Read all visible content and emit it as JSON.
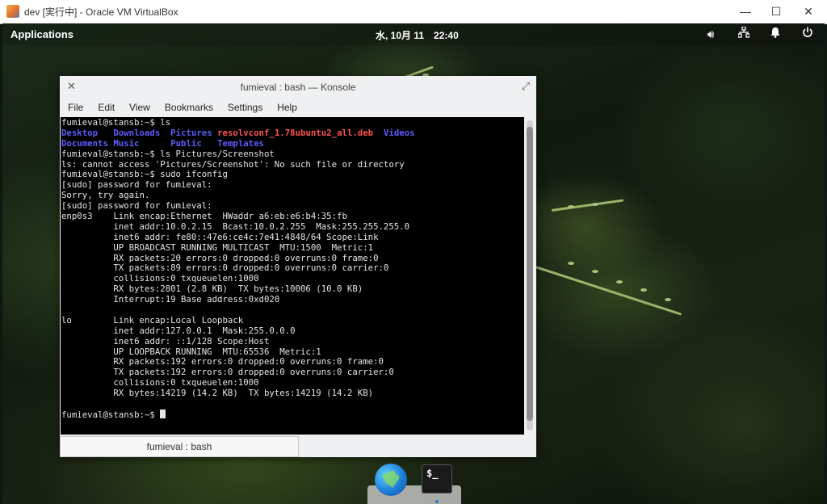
{
  "host_window": {
    "title": "dev [実行中] - Oracle VM VirtualBox",
    "controls": {
      "minimize": "—",
      "maximize": "☐",
      "close": "✕"
    }
  },
  "top_panel": {
    "applications_label": "Applications",
    "date": "水, 10月 11",
    "time": "22:40",
    "tray_icons": [
      "volume-icon",
      "network-icon",
      "notifications-icon",
      "power-icon"
    ]
  },
  "konsole": {
    "title": "fumieval : bash — Konsole",
    "menu": [
      "File",
      "Edit",
      "View",
      "Bookmarks",
      "Settings",
      "Help"
    ],
    "tab_label": "fumieval : bash",
    "lines": [
      "fumieval@stansb:~$ ls",
      "",
      "",
      "fumieval@stansb:~$ ls Pictures/Screenshot",
      "ls: cannot access 'Pictures/Screenshot': No such file or directory",
      "fumieval@stansb:~$ sudo ifconfig",
      "[sudo] password for fumieval:",
      "Sorry, try again.",
      "[sudo] password for fumieval:",
      "enp0s3    Link encap:Ethernet  HWaddr a6:eb:e6:b4:35:fb",
      "          inet addr:10.0.2.15  Bcast:10.0.2.255  Mask:255.255.255.0",
      "          inet6 addr: fe80::47e6:ce4c:7e41:4848/64 Scope:Link",
      "          UP BROADCAST RUNNING MULTICAST  MTU:1500  Metric:1",
      "          RX packets:20 errors:0 dropped:0 overruns:0 frame:0",
      "          TX packets:89 errors:0 dropped:0 overruns:0 carrier:0",
      "          collisions:0 txqueuelen:1000",
      "          RX bytes:2801 (2.8 KB)  TX bytes:10006 (10.0 KB)",
      "          Interrupt:19 Base address:0xd020",
      "",
      "lo        Link encap:Local Loopback",
      "          inet addr:127.0.0.1  Mask:255.0.0.0",
      "          inet6 addr: ::1/128 Scope:Host",
      "          UP LOOPBACK RUNNING  MTU:65536  Metric:1",
      "          RX packets:192 errors:0 dropped:0 overruns:0 frame:0",
      "          TX packets:192 errors:0 dropped:0 overruns:0 carrier:0",
      "          collisions:0 txqueuelen:1000",
      "          RX bytes:14219 (14.2 KB)  TX bytes:14219 (14.2 KB)",
      "",
      "fumieval@stansb:~$ "
    ],
    "ls_output": {
      "row1": [
        "Desktop",
        "Downloads",
        "Pictures",
        "resolvconf_1.78ubuntu2_all.deb",
        "Videos"
      ],
      "row2": [
        "Documents",
        "Music",
        "Public",
        "Templates"
      ]
    },
    "colors": {
      "directory": "#5c5cff",
      "package": "#ff5454",
      "text": "#e6e6e6",
      "background": "#000000"
    }
  },
  "dock": {
    "items": [
      "browser-icon",
      "terminal-icon"
    ],
    "terminal_glyph": "$_"
  }
}
